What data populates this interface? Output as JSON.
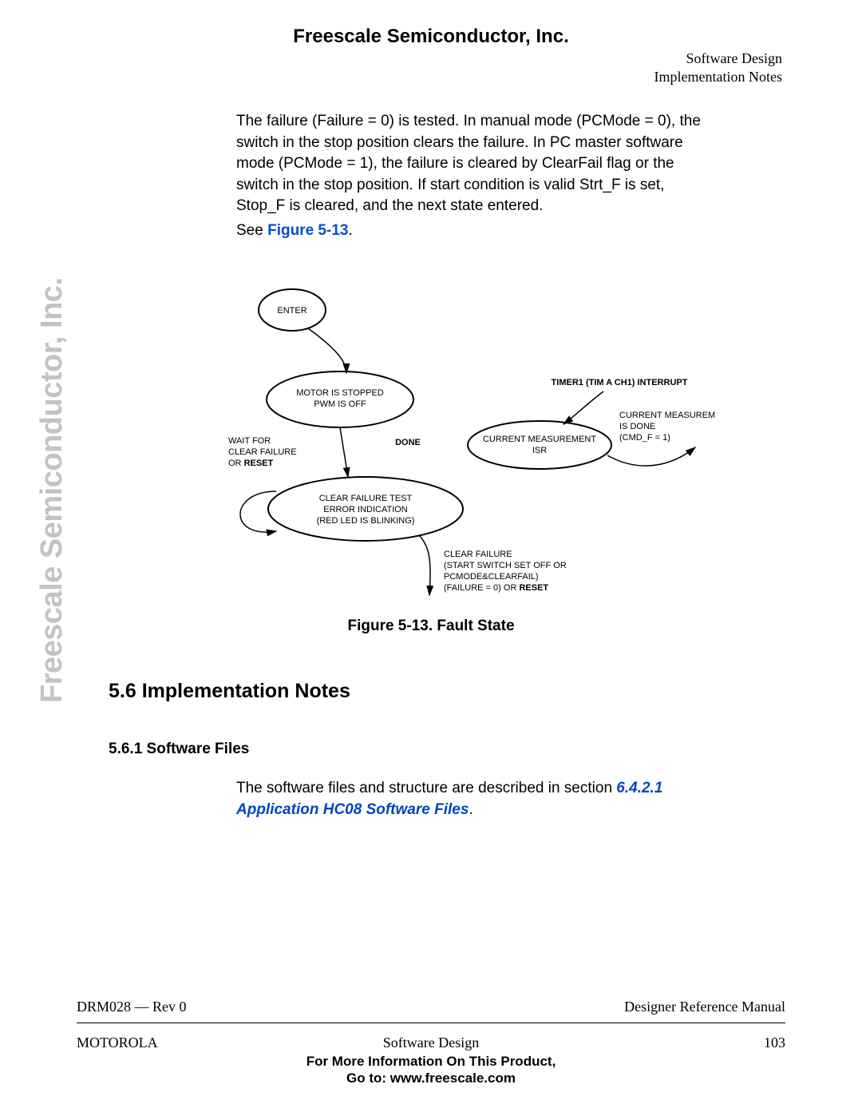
{
  "header": {
    "company": "Freescale Semiconductor, Inc.",
    "section_top1": "Software Design",
    "section_top2": "Implementation Notes"
  },
  "body": {
    "para1": "The failure (Failure = 0) is tested. In manual mode (PCMode = 0), the switch in the stop position clears the failure. In PC master software mode (PCMode = 1), the failure is cleared by ClearFail flag or the switch in the stop position. If start condition is valid Strt_F is set, Stop_F is cleared, and the next state entered.",
    "see_text": "See ",
    "see_link": "Figure 5-13",
    "see_period": "."
  },
  "diagram": {
    "enter": "ENTER",
    "state1_line1": "MOTOR IS STOPPED",
    "state1_line2": "PWM IS OFF",
    "wait1": "WAIT FOR",
    "wait2": "CLEAR FAILURE",
    "wait3_pre": "OR ",
    "wait3_b": "RESET",
    "done": "DONE",
    "state2_line1": "CLEAR FAILURE TEST",
    "state2_line2": "ERROR INDICATION",
    "state2_line3": "(RED LED IS BLINKING)",
    "isr_line1": "CURRENT MEASUREMENT",
    "isr_line2": "ISR",
    "timer": "TIMER1 (TIM A CH1) INTERRUPT",
    "cm1": "CURRENT MEASUREMENT",
    "cm2": "IS DONE",
    "cm3": "(CMD_F = 1)",
    "cf1": "CLEAR FAILURE",
    "cf2": "(START SWITCH SET OFF OR",
    "cf3": "PCMODE&CLEARFAIL)",
    "cf4_pre": "(FAILURE = 0) OR ",
    "cf4_b": "RESET",
    "caption": "Figure 5-13. Fault State"
  },
  "section": {
    "heading": "5.6  Implementation Notes",
    "sub": "5.6.1  Software Files",
    "para2_pre": "The software files and structure are described in section ",
    "para2_link": "6.4.2.1 Application HC08 Software Files",
    "para2_post": "."
  },
  "watermark": "Freescale Semiconductor, Inc.",
  "footer": {
    "rev": "DRM028 — Rev 0",
    "manual": "Designer Reference Manual",
    "brand": "MOTOROLA",
    "center": "Software Design",
    "page": "103",
    "more1": "For More Information On This Product,",
    "more2": "Go to: www.freescale.com"
  }
}
